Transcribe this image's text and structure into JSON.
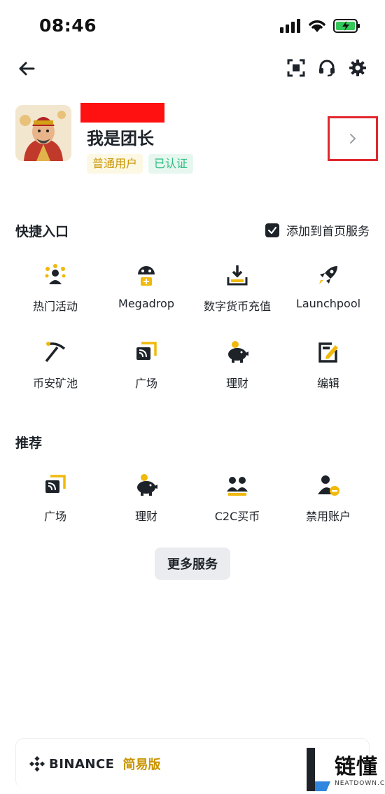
{
  "status_bar": {
    "time": "08:46"
  },
  "profile": {
    "username": "我是团长",
    "badge_user": "普通用户",
    "badge_verified": "已认证"
  },
  "quick_access": {
    "title": "快捷入口",
    "add_to_home": "添加到首页服务",
    "add_to_home_checked": true,
    "items": [
      {
        "label": "热门活动",
        "icon": "people-celebrate-icon"
      },
      {
        "label": "Megadrop",
        "icon": "megadrop-icon"
      },
      {
        "label": "数字货币充值",
        "icon": "deposit-icon"
      },
      {
        "label": "Launchpool",
        "icon": "rocket-icon"
      },
      {
        "label": "币安矿池",
        "icon": "pickaxe-icon"
      },
      {
        "label": "广场",
        "icon": "square-feed-icon"
      },
      {
        "label": "理财",
        "icon": "piggy-bank-icon"
      },
      {
        "label": "编辑",
        "icon": "edit-icon"
      }
    ]
  },
  "recommend": {
    "title": "推荐",
    "items": [
      {
        "label": "广场",
        "icon": "square-feed-icon"
      },
      {
        "label": "理财",
        "icon": "piggy-bank-icon"
      },
      {
        "label": "C2C买币",
        "icon": "c2c-users-icon"
      },
      {
        "label": "禁用账户",
        "icon": "disable-account-icon"
      }
    ]
  },
  "more_services": "更多服务",
  "footer": {
    "brand": "BINANCE",
    "mode": "简易版"
  },
  "watermark": {
    "cn": "链懂",
    "en": "NEATDOWN.COM"
  },
  "colors": {
    "accent": "#F0B90B",
    "text": "#1E2329",
    "highlight_border": "#E0282E"
  }
}
